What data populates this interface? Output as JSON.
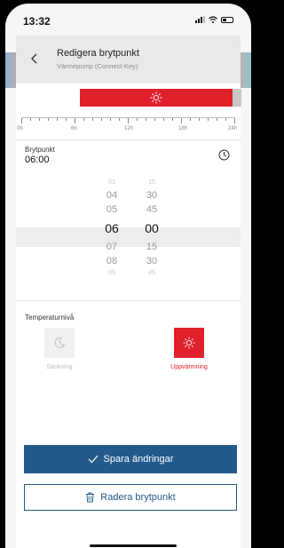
{
  "status_bar": {
    "time": "13:32"
  },
  "header": {
    "title": "Redigera brytpunkt",
    "subtitle": "Värmepump (Connect-Key)"
  },
  "timeline": {
    "tick_labels": [
      "0h",
      "6h",
      "12h",
      "18h",
      "24h"
    ],
    "segment_color": "#e0212b"
  },
  "breakpoint": {
    "label": "Brytpunkt",
    "value": "06:00"
  },
  "picker": {
    "hours": [
      "03",
      "04",
      "05",
      "06",
      "07",
      "08",
      "09"
    ],
    "minutes": [
      "15",
      "30",
      "45",
      "00",
      "15",
      "30",
      "45"
    ],
    "selected_hour": "06",
    "selected_minute": "00"
  },
  "temperature": {
    "label": "Temperaturnivå",
    "options": [
      {
        "label": "Sänkning",
        "icon": "moon-icon",
        "selected": false
      },
      {
        "label": "Uppvärmning",
        "icon": "sun-icon",
        "selected": true
      }
    ]
  },
  "actions": {
    "save_label": "Spara ändringar",
    "delete_label": "Radera brytpunkt"
  },
  "colors": {
    "accent": "#235a8c",
    "heat": "#e0212b"
  }
}
